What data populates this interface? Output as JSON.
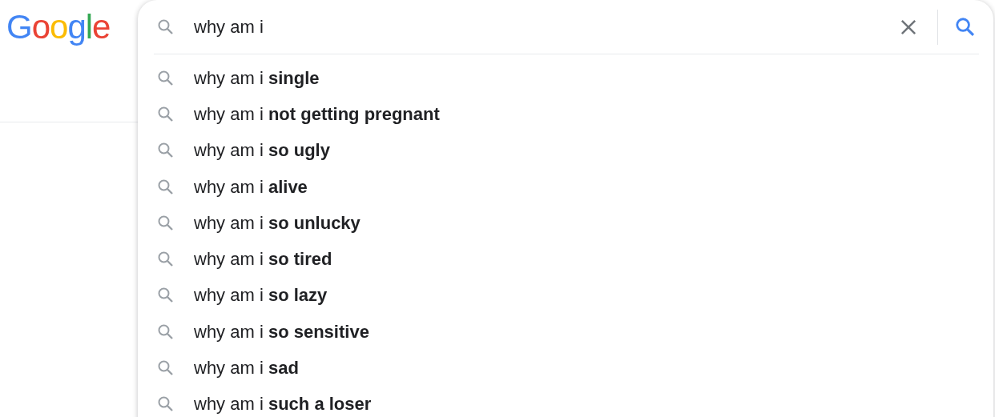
{
  "logo": "Google",
  "search": {
    "value": "why am i"
  },
  "suggestions": [
    "why am i **single**",
    "why am i **not getting pregnant**",
    "why am i **so ugly**",
    "why am i **alive**",
    "why am i **so unlucky**",
    "why am i **so tired**",
    "why am i **so lazy**",
    "why am i **so sensitive**",
    "why am i **sad**",
    "why am i **such a loser**"
  ]
}
